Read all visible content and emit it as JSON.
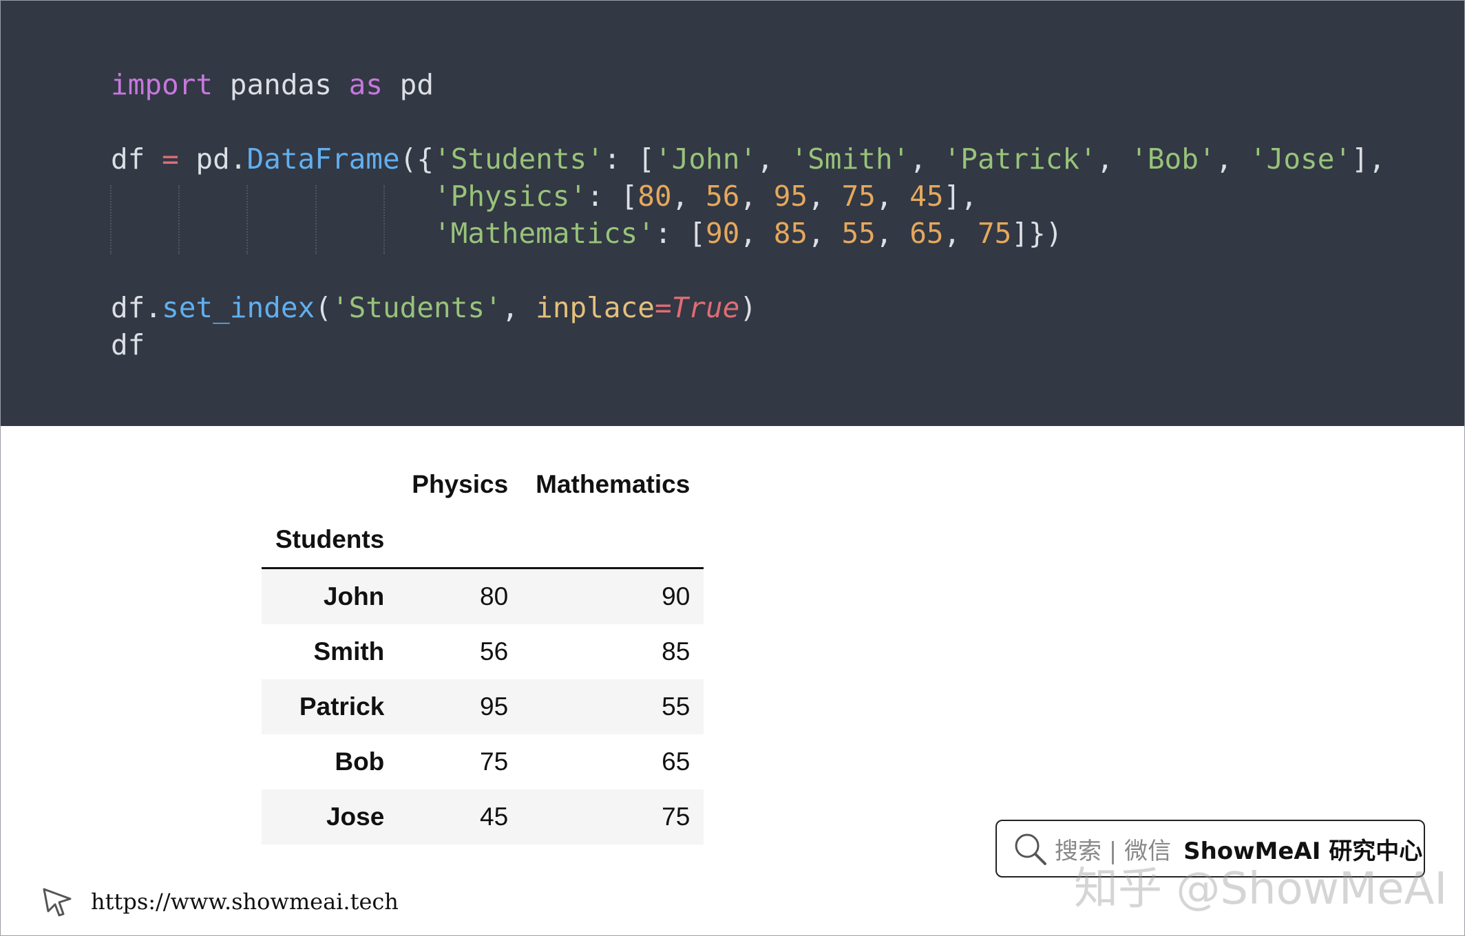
{
  "code": {
    "lines": [
      [
        {
          "t": "import",
          "c": "kw"
        },
        {
          "t": " pandas "
        },
        {
          "t": "as",
          "c": "kw"
        },
        {
          "t": " pd"
        }
      ],
      [],
      [
        {
          "t": "df "
        },
        {
          "t": "=",
          "c": "op"
        },
        {
          "t": " pd."
        },
        {
          "t": "DataFrame",
          "c": "fn"
        },
        {
          "t": "({"
        },
        {
          "t": "'Students'",
          "c": "str"
        },
        {
          "t": ": ["
        },
        {
          "t": "'John'",
          "c": "str"
        },
        {
          "t": ", "
        },
        {
          "t": "'Smith'",
          "c": "str"
        },
        {
          "t": ", "
        },
        {
          "t": "'Patrick'",
          "c": "str"
        },
        {
          "t": ", "
        },
        {
          "t": "'Bob'",
          "c": "str"
        },
        {
          "t": ", "
        },
        {
          "t": "'Jose'",
          "c": "str"
        },
        {
          "t": "],"
        }
      ],
      [
        {
          "t": "                   "
        },
        {
          "t": "'Physics'",
          "c": "str"
        },
        {
          "t": ": ["
        },
        {
          "t": "80",
          "c": "num"
        },
        {
          "t": ", "
        },
        {
          "t": "56",
          "c": "num"
        },
        {
          "t": ", "
        },
        {
          "t": "95",
          "c": "num"
        },
        {
          "t": ", "
        },
        {
          "t": "75",
          "c": "num"
        },
        {
          "t": ", "
        },
        {
          "t": "45",
          "c": "num"
        },
        {
          "t": "],"
        }
      ],
      [
        {
          "t": "                   "
        },
        {
          "t": "'Mathematics'",
          "c": "str"
        },
        {
          "t": ": ["
        },
        {
          "t": "90",
          "c": "num"
        },
        {
          "t": ", "
        },
        {
          "t": "85",
          "c": "num"
        },
        {
          "t": ", "
        },
        {
          "t": "55",
          "c": "num"
        },
        {
          "t": ", "
        },
        {
          "t": "65",
          "c": "num"
        },
        {
          "t": ", "
        },
        {
          "t": "75",
          "c": "num"
        },
        {
          "t": "]})"
        }
      ],
      [],
      [
        {
          "t": "df."
        },
        {
          "t": "set_index",
          "c": "fn"
        },
        {
          "t": "("
        },
        {
          "t": "'Students'",
          "c": "str"
        },
        {
          "t": ", "
        },
        {
          "t": "inplace",
          "c": "param"
        },
        {
          "t": "=",
          "c": "op"
        },
        {
          "t": "True",
          "c": "bool"
        },
        {
          "t": ")"
        }
      ],
      [
        {
          "t": "df"
        }
      ]
    ]
  },
  "table": {
    "columns": [
      "Physics",
      "Mathematics"
    ],
    "index_name": "Students",
    "rows": [
      {
        "index": "John",
        "values": [
          "80",
          "90"
        ]
      },
      {
        "index": "Smith",
        "values": [
          "56",
          "85"
        ]
      },
      {
        "index": "Patrick",
        "values": [
          "95",
          "55"
        ]
      },
      {
        "index": "Bob",
        "values": [
          "75",
          "65"
        ]
      },
      {
        "index": "Jose",
        "values": [
          "45",
          "75"
        ]
      }
    ]
  },
  "brand": {
    "search_label": "搜索 | 微信",
    "name": "ShowMeAI 研究中心",
    "watermark": "知乎 @ShowMeAI"
  },
  "footer": {
    "url": "https://www.showmeai.tech"
  },
  "colors": {
    "code_bg": "#323844",
    "keyword": "#c678dd",
    "function": "#61afef",
    "string": "#98c379",
    "number": "#e5a85c",
    "operator": "#e06c75"
  },
  "icons": {
    "search": "magnifier-icon",
    "cursor": "cursor-arrow-icon"
  }
}
